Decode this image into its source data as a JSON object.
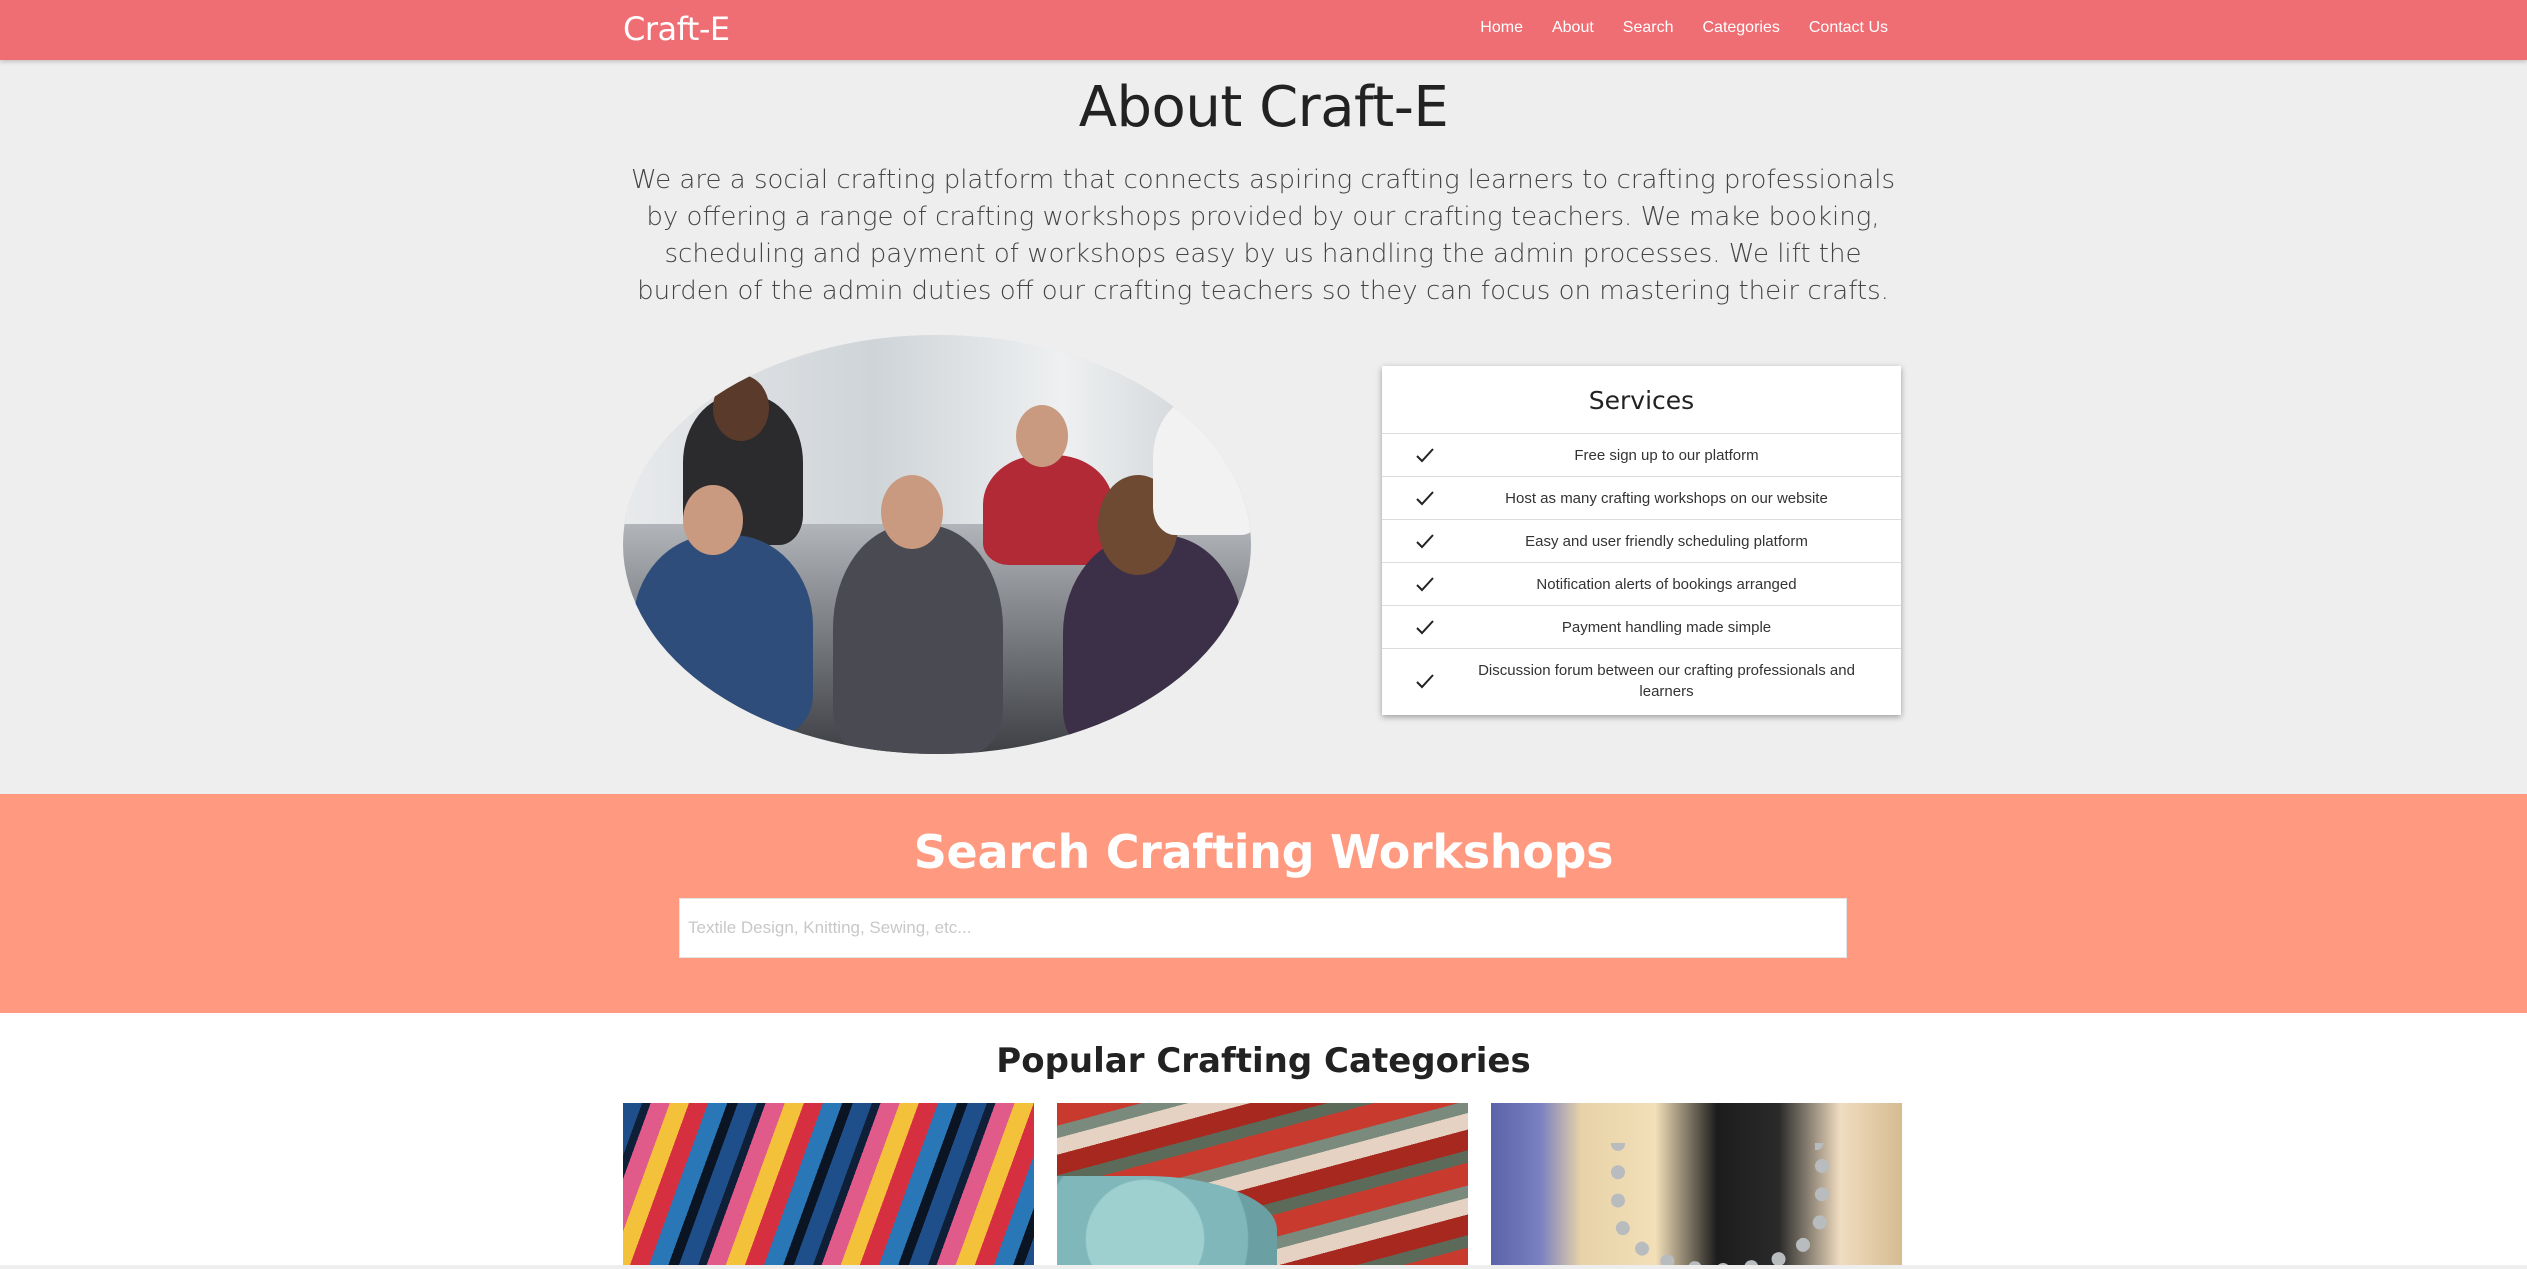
{
  "nav": {
    "brand": "Craft-E",
    "links": [
      "Home",
      "About",
      "Search",
      "Categories",
      "Contact Us"
    ]
  },
  "about": {
    "title": "About Craft-E",
    "text": "We are a social crafting platform that connects aspiring crafting learners to crafting professionals by offering a range of crafting workshops provided by our crafting teachers. We make booking, scheduling and payment of workshops easy by us handling the admin processes. We lift the burden of the admin duties off our crafting teachers so they can focus on mastering their crafts."
  },
  "services": {
    "title": "Services",
    "items": [
      "Free sign up to our platform",
      "Host as many crafting workshops on our website",
      "Easy and user friendly scheduling platform",
      "Notification alerts of bookings arranged",
      "Payment handling made simple",
      "Discussion forum between our crafting professionals and learners"
    ]
  },
  "search": {
    "title": "Search Crafting Workshops",
    "placeholder": "Textile Design, Knitting, Sewing, etc...",
    "value": ""
  },
  "categories": {
    "title": "Popular Crafting Categories"
  },
  "colors": {
    "navbar": "#ef6e74",
    "search_band": "#ff9a80",
    "page_bg": "#eeeeee"
  }
}
